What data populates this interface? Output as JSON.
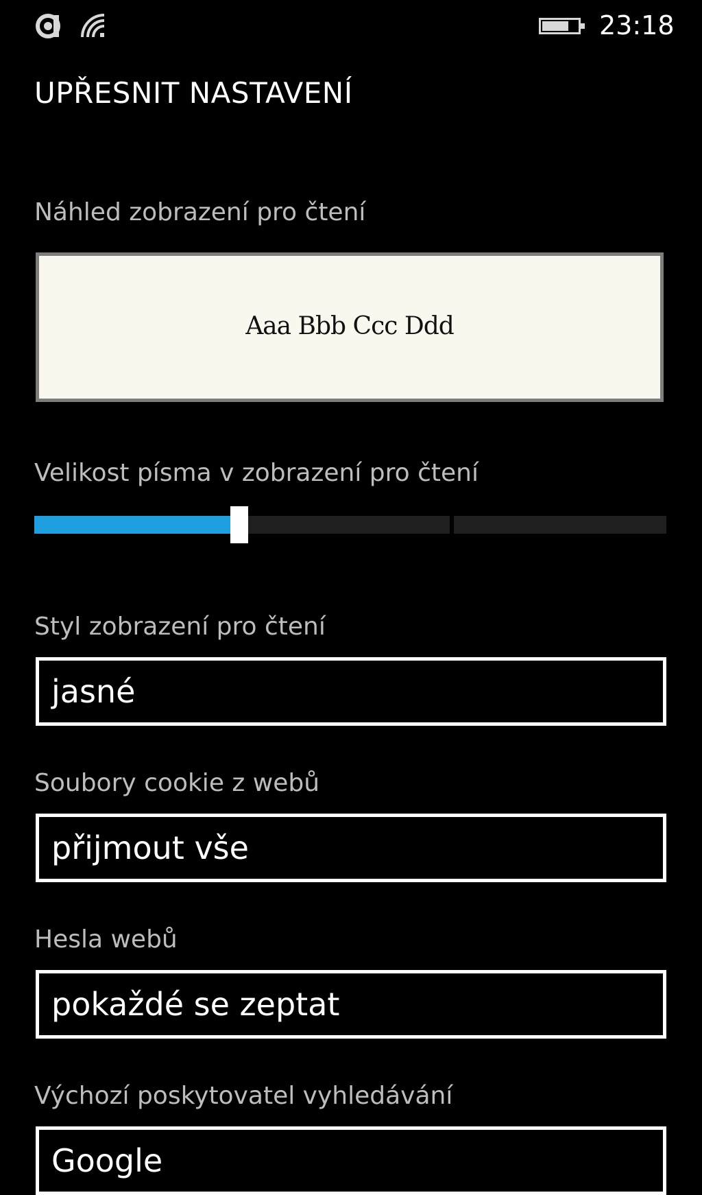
{
  "status_bar": {
    "time": "23:18",
    "icons": [
      "signal-icon",
      "wifi-icon",
      "battery-icon"
    ],
    "battery_level": 0.75
  },
  "page": {
    "title": "UPŘESNIT NASTAVENÍ"
  },
  "reading_preview": {
    "label": "Náhled zobrazení pro čtení",
    "sample_text": "Aaa Bbb Ccc Ddd",
    "background_color": "#faf7ef"
  },
  "font_size": {
    "label": "Velikost písma v zobrazení pro čtení",
    "level": 0.31,
    "accent_color": "#1ea0e0"
  },
  "reading_style": {
    "label": "Styl zobrazení pro čtení",
    "value": "jasné"
  },
  "cookies": {
    "label": "Soubory cookie z webů",
    "value": "přijmout vše"
  },
  "passwords": {
    "label": "Hesla webů",
    "value": "pokaždé se zeptat"
  },
  "search_provider": {
    "label": "Výchozí poskytovatel vyhledávání",
    "value": "Google"
  }
}
